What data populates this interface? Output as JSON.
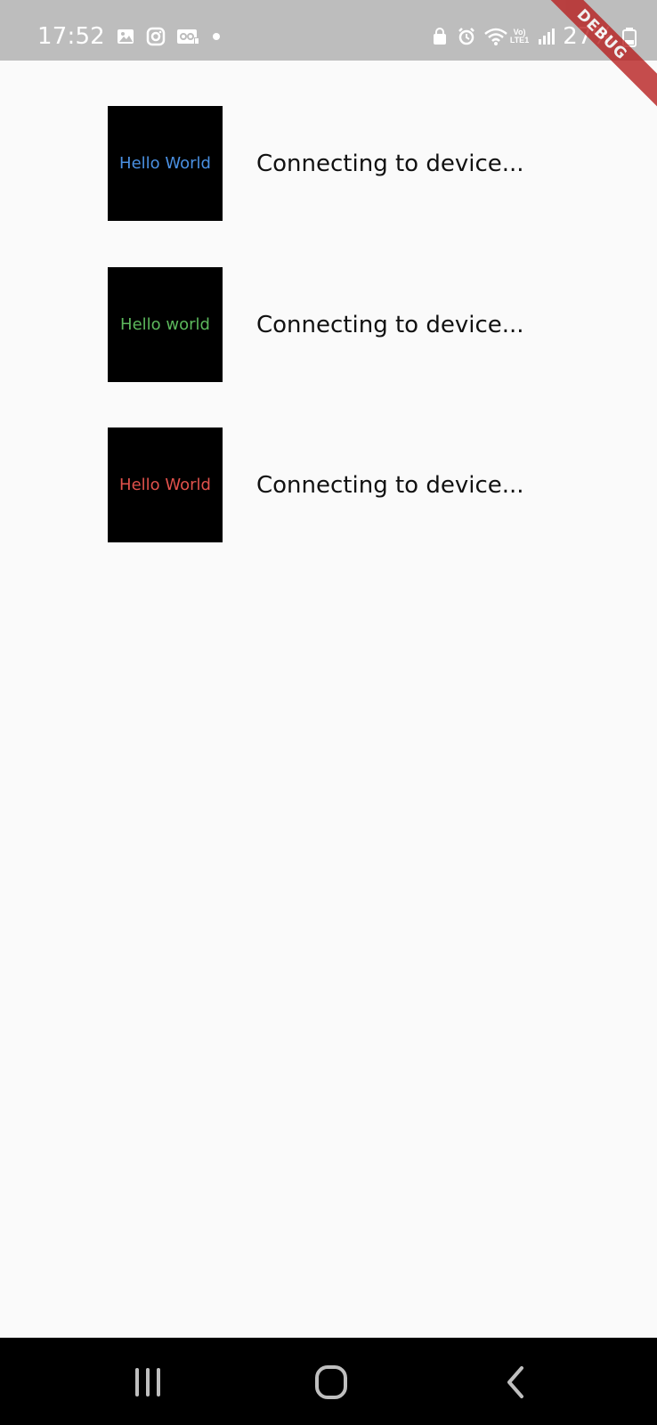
{
  "status_bar": {
    "time": "17:52",
    "battery": "27%",
    "lte_top": "Vo)",
    "lte_bottom": "LTE1",
    "left_icons": [
      "gallery-icon",
      "instagram-icon",
      "voicemail-icon",
      "dot-icon"
    ],
    "right_icons": [
      "lock-icon",
      "alarm-icon",
      "wifi-icon",
      "lte-icon",
      "signal-icon",
      "battery-icon"
    ]
  },
  "debug_banner": "DEBUG",
  "devices": [
    {
      "thumb_text": "Hello World",
      "thumb_color": "#4a90e2",
      "status": "Connecting to device..."
    },
    {
      "thumb_text": "Hello world",
      "thumb_color": "#5cb85c",
      "status": "Connecting to device..."
    },
    {
      "thumb_text": "Hello World",
      "thumb_color": "#e0514b",
      "status": "Connecting to device..."
    }
  ],
  "nav_bar": {
    "buttons": [
      "recent-apps-icon",
      "home-icon",
      "back-icon"
    ]
  }
}
